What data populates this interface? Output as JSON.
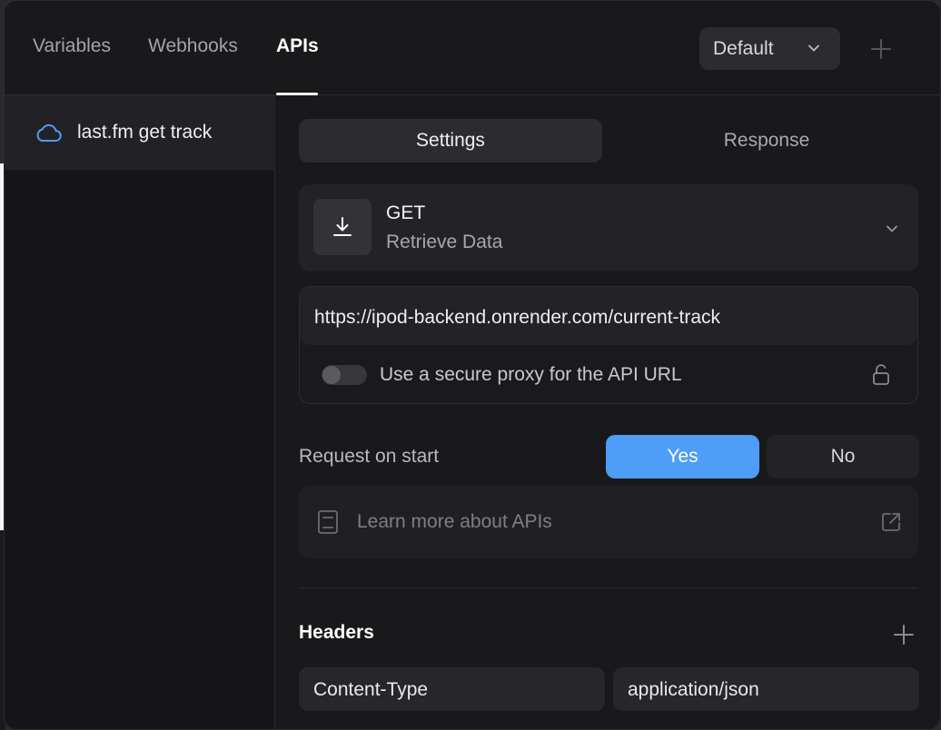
{
  "topbar": {
    "tabs": [
      {
        "label": "Variables",
        "active": false
      },
      {
        "label": "Webhooks",
        "active": false
      },
      {
        "label": "APIs",
        "active": true
      }
    ],
    "environment": "Default",
    "add_icon": "plus-icon"
  },
  "sidebar": {
    "items": [
      {
        "label": "last.fm get track",
        "icon": "cloud-icon",
        "selected": true
      }
    ]
  },
  "main": {
    "segmented": {
      "settings": "Settings",
      "response": "Response",
      "active": "Settings"
    },
    "method": {
      "name": "GET",
      "description": "Retrieve Data",
      "icon": "download-icon"
    },
    "url": {
      "value": "https://ipod-backend.onrender.com/current-track",
      "proxy_label": "Use a secure proxy for the API URL",
      "proxy_enabled": false,
      "lock_icon": "unlock-icon"
    },
    "request_on_start": {
      "label": "Request on start",
      "yes": "Yes",
      "no": "No",
      "selected": "Yes"
    },
    "learn_more": {
      "text": "Learn more about APIs",
      "icon": "book-icon",
      "link_icon": "external-link-icon"
    },
    "headers": {
      "title": "Headers",
      "rows": [
        {
          "key": "Content-Type",
          "value": "application/json"
        }
      ]
    }
  },
  "colors": {
    "accent": "#4e9df7",
    "panel_bg": "#19191c",
    "card_bg": "#232327"
  }
}
